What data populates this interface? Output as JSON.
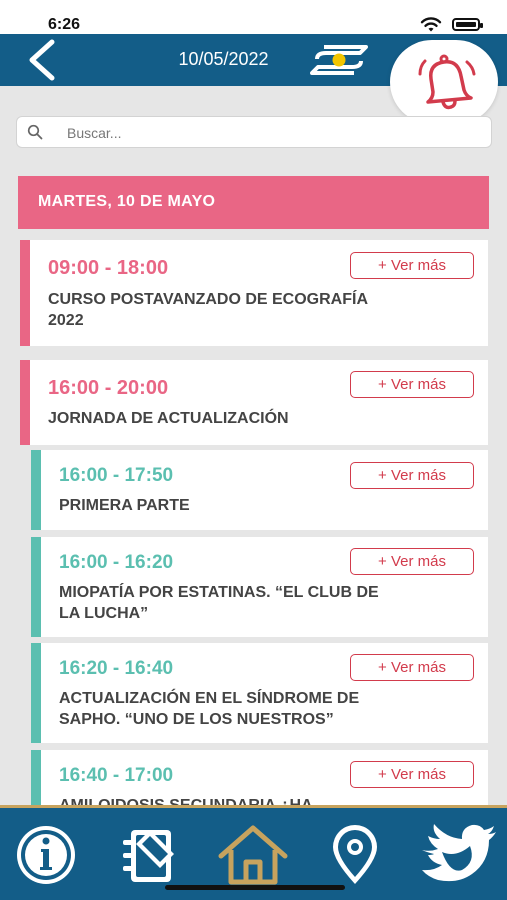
{
  "status_bar": {
    "time": "6:26"
  },
  "header": {
    "date": "10/05/2022"
  },
  "search": {
    "placeholder": "Buscar..."
  },
  "day_header": {
    "label": "MARTES, 10 DE MAYO"
  },
  "colors": {
    "primary": "#135d88",
    "accent_pink": "#e96685",
    "accent_teal": "#5bbfb0",
    "button_red": "#d23b4c",
    "tab_border": "#c7a35e"
  },
  "events": [
    {
      "time": "09:00 - 18:00",
      "title_lines": [
        "CURSO POSTAVANZADO DE ECOGRAFÍA",
        "2022"
      ],
      "button": "+ Ver más",
      "level": "main"
    },
    {
      "time": "16:00 - 20:00",
      "title_lines": [
        "JORNADA DE ACTUALIZACIÓN"
      ],
      "button": "+ Ver más",
      "level": "main"
    },
    {
      "time": "16:00 - 17:50",
      "title_lines": [
        "PRIMERA PARTE"
      ],
      "button": "+ Ver más",
      "level": "sub"
    },
    {
      "time": "16:00 - 16:20",
      "title_lines": [
        "MIOPATÍA POR ESTATINAS. “EL CLUB DE",
        "LA LUCHA”"
      ],
      "button": "+ Ver más",
      "level": "sub"
    },
    {
      "time": "16:20 - 16:40",
      "title_lines": [
        "ACTUALIZACIÓN EN EL SÍNDROME DE",
        "SAPHO. “UNO DE LOS NUESTROS”"
      ],
      "button": "+ Ver más",
      "level": "sub"
    },
    {
      "time": "16:40 - 17:00",
      "title_lines": [
        "AMILOIDOSIS SECUNDARIA ¿HA"
      ],
      "button": "+ Ver más",
      "level": "sub"
    }
  ],
  "tabs": [
    {
      "icon": "info-icon"
    },
    {
      "icon": "notebook-icon"
    },
    {
      "icon": "home-icon"
    },
    {
      "icon": "location-pin-icon"
    },
    {
      "icon": "twitter-bird-icon"
    }
  ]
}
